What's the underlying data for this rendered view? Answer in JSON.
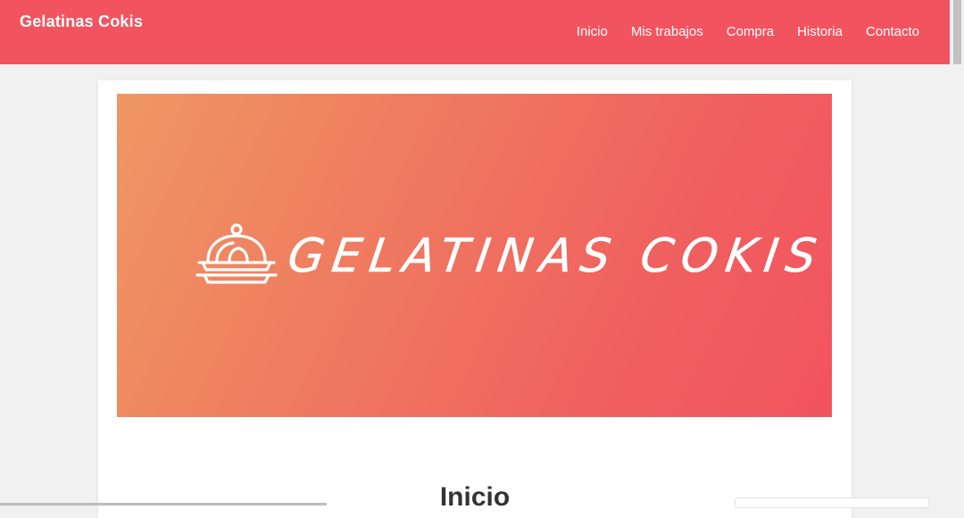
{
  "navbar": {
    "brand": "Gelatinas Cokis",
    "links": [
      {
        "label": "Inicio"
      },
      {
        "label": "Mis trabajos"
      },
      {
        "label": "Compra"
      },
      {
        "label": "Historia"
      },
      {
        "label": "Contacto"
      }
    ],
    "background_color": "#f2545f"
  },
  "banner": {
    "logo_text": "GELATINAS COKIS",
    "logo_icon": "covered-dessert-platter-icon",
    "gradient_colors": [
      "#ef9762",
      "#f2535f"
    ]
  },
  "main": {
    "section_title": "Inicio"
  }
}
